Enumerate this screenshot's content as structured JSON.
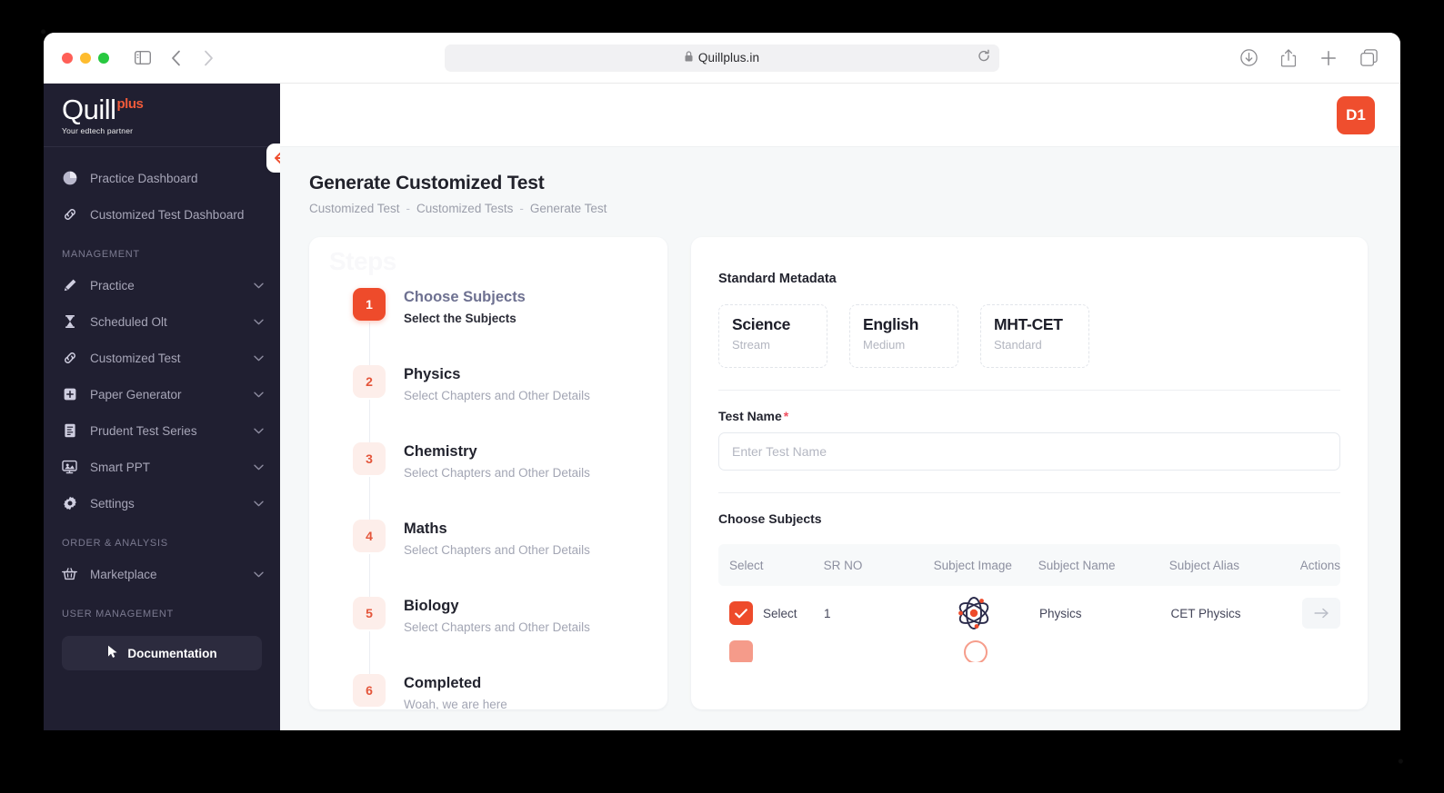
{
  "browser": {
    "url": "Quillplus.in",
    "lock_icon": "lock-icon",
    "sidebar_toggle_icon": "sidebar-toggle-icon",
    "back_icon": "back-chevron-icon",
    "forward_icon": "forward-chevron-icon",
    "shield_icon": "privacy-shield-icon",
    "reload_icon": "reload-icon",
    "downloads_icon": "downloads-icon",
    "share_icon": "share-icon",
    "new_tab_icon": "plus-icon",
    "tabs_icon": "tab-overview-icon"
  },
  "sidebar": {
    "brand": {
      "name": "Quill",
      "superscript": "plus",
      "tagline": "Your edtech partner"
    },
    "collapse_icon": "arrow-left-icon",
    "top_items": [
      {
        "label": "Practice Dashboard",
        "icon": "pie-chart-icon"
      },
      {
        "label": "Customized Test Dashboard",
        "icon": "link-icon"
      }
    ],
    "sections": [
      {
        "title": "MANAGEMENT",
        "items": [
          {
            "label": "Practice",
            "icon": "pencil-icon",
            "chevron": "chevron-down-icon"
          },
          {
            "label": "Scheduled Olt",
            "icon": "hourglass-icon",
            "chevron": "chevron-down-icon"
          },
          {
            "label": "Customized Test",
            "icon": "link-icon",
            "chevron": "chevron-down-icon"
          },
          {
            "label": "Paper Generator",
            "icon": "plus-square-icon",
            "chevron": "chevron-down-icon"
          },
          {
            "label": "Prudent Test Series",
            "icon": "document-lines-icon",
            "chevron": "chevron-down-icon"
          },
          {
            "label": "Smart PPT",
            "icon": "presentation-icon",
            "chevron": "chevron-down-icon"
          },
          {
            "label": "Settings",
            "icon": "gear-icon",
            "chevron": "chevron-down-icon"
          }
        ]
      },
      {
        "title": "ORDER & ANALYSIS",
        "items": [
          {
            "label": "Marketplace",
            "icon": "basket-icon",
            "chevron": "chevron-down-icon"
          }
        ]
      },
      {
        "title": "USER MANAGEMENT",
        "items": []
      }
    ],
    "documentation_button": {
      "label": "Documentation",
      "icon": "cursor-icon"
    }
  },
  "topbar": {
    "avatar_initials": "D1"
  },
  "page": {
    "title": "Generate Customized Test",
    "breadcrumb": [
      "Customized Test",
      "Customized Tests",
      "Generate Test"
    ],
    "breadcrumb_separator": "-"
  },
  "stepper": {
    "watermark": "Steps",
    "steps": [
      {
        "num": "1",
        "title": "Choose Subjects",
        "desc": "Select the Subjects",
        "active": true
      },
      {
        "num": "2",
        "title": "Physics",
        "desc": "Select Chapters and Other Details",
        "active": false
      },
      {
        "num": "3",
        "title": "Chemistry",
        "desc": "Select Chapters and Other Details",
        "active": false
      },
      {
        "num": "4",
        "title": "Maths",
        "desc": "Select Chapters and Other Details",
        "active": false
      },
      {
        "num": "5",
        "title": "Biology",
        "desc": "Select Chapters and Other Details",
        "active": false
      },
      {
        "num": "6",
        "title": "Completed",
        "desc": "Woah, we are here",
        "active": false
      }
    ]
  },
  "form": {
    "metadata_label": "Standard Metadata",
    "metadata": [
      {
        "value": "Science",
        "key": "Stream"
      },
      {
        "value": "English",
        "key": "Medium"
      },
      {
        "value": "MHT-CET",
        "key": "Standard"
      }
    ],
    "test_name_label": "Test Name",
    "required_marker": "*",
    "test_name_value": "",
    "test_name_placeholder": "Enter Test Name",
    "choose_subjects_label": "Choose Subjects",
    "table": {
      "columns": [
        "Select",
        "SR NO",
        "Subject Image",
        "Subject Name",
        "Subject Alias",
        "Actions"
      ],
      "rows": [
        {
          "select_label": "Select",
          "checked": true,
          "sr_no": "1",
          "image_icon": "atom-icon",
          "subject_name": "Physics",
          "subject_alias": "CET Physics",
          "action_icon": "arrow-right-icon"
        }
      ]
    }
  },
  "colors": {
    "accent": "#ee4b2b",
    "sidebar_bg": "#201f31",
    "page_bg": "#f6f8f9",
    "text_dark": "#22232e"
  }
}
